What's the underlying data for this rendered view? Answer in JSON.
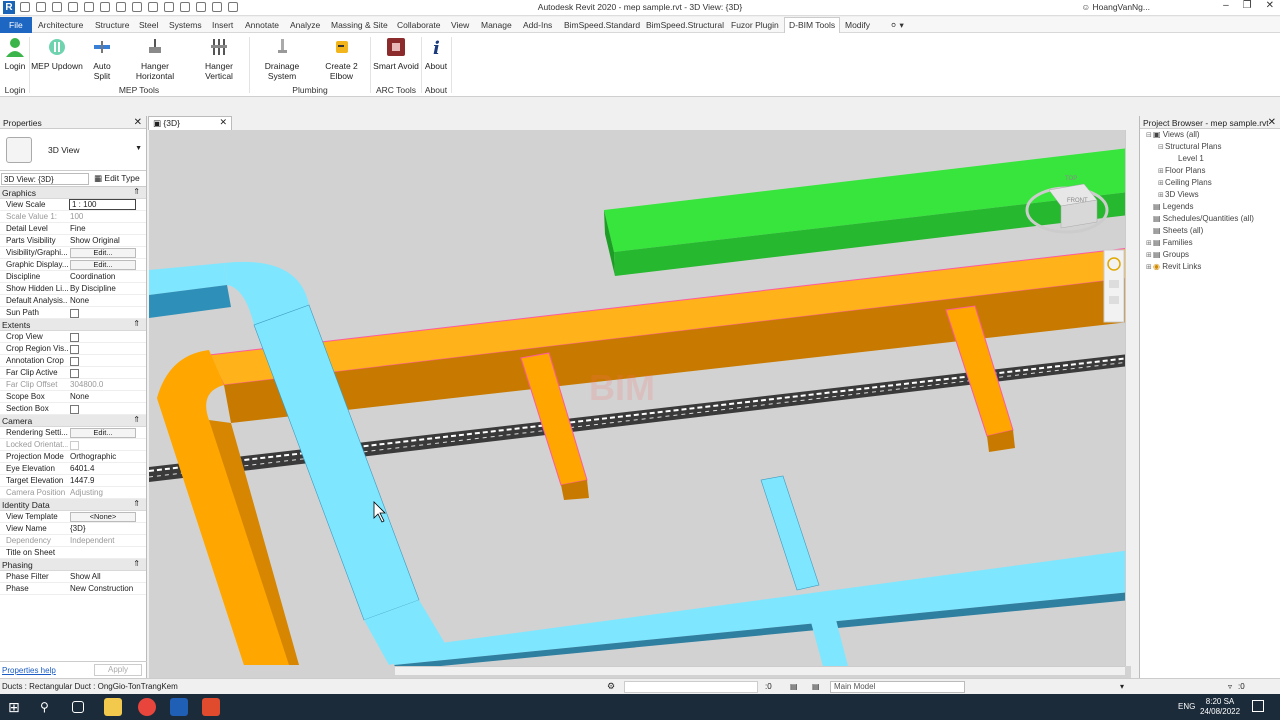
{
  "window": {
    "title": "Autodesk Revit 2020 - mep sample.rvt - 3D View: {3D}",
    "user": "HoangVanNg..."
  },
  "menu": {
    "file": "File",
    "tabs": [
      "Architecture",
      "Structure",
      "Steel",
      "Systems",
      "Insert",
      "Annotate",
      "Analyze",
      "Massing & Site",
      "Collaborate",
      "View",
      "Manage",
      "Add-Ins",
      "BimSpeed.Standard",
      "BimSpeed.Structural",
      "Fuzor Plugin",
      "D-BIM Tools",
      "Modify"
    ],
    "active": "D-BIM Tools"
  },
  "ribbon": {
    "tools": [
      {
        "label": "Login",
        "icon": "login-user-icon"
      },
      {
        "label": "MEP Updown",
        "icon": "mep-updown-icon"
      },
      {
        "label": "Auto Split",
        "icon": "auto-split-icon"
      },
      {
        "label": "Hanger Horizontal",
        "icon": "hanger-horizontal-icon"
      },
      {
        "label": "Hanger Vertical",
        "icon": "hanger-vertical-icon"
      },
      {
        "label": "Drainage System",
        "icon": "drainage-icon"
      },
      {
        "label": "Create 2 Elbow",
        "icon": "elbow-icon"
      },
      {
        "label": "Smart Avoid",
        "icon": "smart-avoid-icon"
      },
      {
        "label": "About",
        "icon": "info-icon"
      }
    ],
    "groups": [
      "Login",
      "MEP Tools",
      "Plumbing",
      "ARC Tools",
      "About"
    ]
  },
  "properties": {
    "title": "Properties",
    "type": "3D View",
    "view_selector": "3D View: {3D}",
    "edit_type": "Edit Type",
    "sections": {
      "graphics": "Graphics",
      "extents": "Extents",
      "camera": "Camera",
      "identity": "Identity Data",
      "phasing": "Phasing"
    },
    "rows": {
      "view_scale": [
        "View Scale",
        "1 : 100"
      ],
      "scale_value": [
        "Scale Value    1:",
        "100"
      ],
      "detail_level": [
        "Detail Level",
        "Fine"
      ],
      "parts_visibility": [
        "Parts Visibility",
        "Show Original"
      ],
      "visibility_graphics": [
        "Visibility/Graphi...",
        "Edit..."
      ],
      "graphic_display": [
        "Graphic Display...",
        "Edit..."
      ],
      "discipline": [
        "Discipline",
        "Coordination"
      ],
      "show_hidden": [
        "Show Hidden Li...",
        "By Discipline"
      ],
      "default_analysis": [
        "Default Analysis...",
        "None"
      ],
      "sun_path": [
        "Sun Path",
        ""
      ],
      "crop_view": [
        "Crop View",
        ""
      ],
      "crop_region": [
        "Crop Region Vis...",
        ""
      ],
      "annotation_crop": [
        "Annotation Crop",
        ""
      ],
      "far_clip_active": [
        "Far Clip Active",
        ""
      ],
      "far_clip_offset": [
        "Far Clip Offset",
        "304800.0"
      ],
      "scope_box": [
        "Scope Box",
        "None"
      ],
      "section_box": [
        "Section Box",
        ""
      ],
      "rendering": [
        "Rendering Setti...",
        "Edit..."
      ],
      "locked_orient": [
        "Locked Orientat...",
        ""
      ],
      "projection": [
        "Projection Mode",
        "Orthographic"
      ],
      "eye_elev": [
        "Eye Elevation",
        "6401.4"
      ],
      "target_elev": [
        "Target Elevation",
        "1447.9"
      ],
      "camera_pos": [
        "Camera Position",
        "Adjusting"
      ],
      "view_template": [
        "View Template",
        "<None>"
      ],
      "view_name": [
        "View Name",
        "{3D}"
      ],
      "dependency": [
        "Dependency",
        "Independent"
      ],
      "title_sheet": [
        "Title on Sheet",
        ""
      ],
      "phase_filter": [
        "Phase Filter",
        "Show All"
      ],
      "phase": [
        "Phase",
        "New Construction"
      ]
    },
    "help": "Properties help",
    "apply": "Apply"
  },
  "view_tab": "{3D}",
  "browser": {
    "title": "Project Browser - mep sample.rvt",
    "nodes": [
      "Views (all)",
      "Structural Plans",
      "Level 1",
      "Floor Plans",
      "Ceiling Plans",
      "3D Views",
      "Legends",
      "Schedules/Quantities (all)",
      "Sheets (all)",
      "Families",
      "Groups",
      "Revit Links"
    ]
  },
  "viewcube": {
    "top": "TOP",
    "front": "FRONT"
  },
  "status": {
    "message": "Ducts : Rectangular Duct : OngGio-TonTrangKem",
    "zero": ":0",
    "model": "Main Model"
  },
  "taskbar": {
    "lang": "ENG",
    "time": "8:20 SA",
    "date": "24/08/2022"
  },
  "colors": {
    "accent": "#1d66c2",
    "duct_blue": "#7fe6ff",
    "duct_orange": "#ffa600",
    "duct_green": "#33e33a"
  }
}
